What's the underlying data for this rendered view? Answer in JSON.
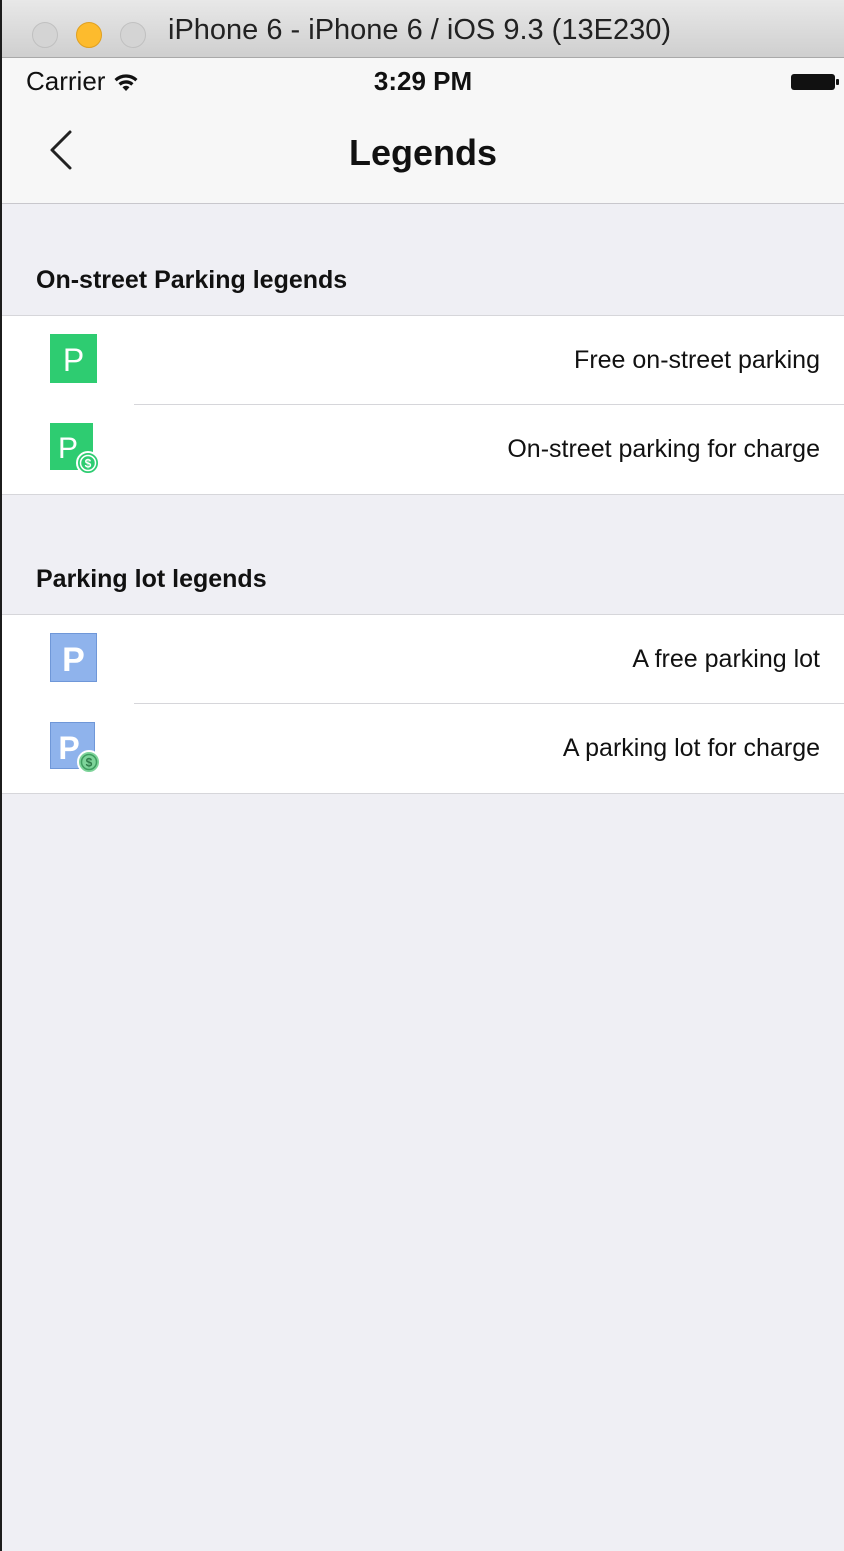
{
  "window": {
    "title": "iPhone 6 - iPhone 6 / iOS 9.3 (13E230)"
  },
  "status_bar": {
    "carrier": "Carrier",
    "time": "3:29 PM"
  },
  "nav": {
    "title": "Legends"
  },
  "sections": [
    {
      "header": "On-street Parking legends",
      "items": [
        {
          "icon": "green-parking-icon",
          "glyph": "P",
          "label": "Free on-street parking"
        },
        {
          "icon": "green-parking-charge-icon",
          "glyph": "P",
          "badge": "$",
          "label": "On-street parking for charge"
        }
      ]
    },
    {
      "header": "Parking lot legends",
      "items": [
        {
          "icon": "blue-parking-icon",
          "glyph": "P",
          "label": "A free parking lot"
        },
        {
          "icon": "blue-parking-charge-icon",
          "glyph": "P",
          "badge": "$",
          "label": "A parking lot for charge"
        }
      ]
    }
  ],
  "colors": {
    "green": "#2ecc71",
    "blue": "#8fb3ec",
    "badge_green": "#7ed49a",
    "background": "#efeff4"
  }
}
